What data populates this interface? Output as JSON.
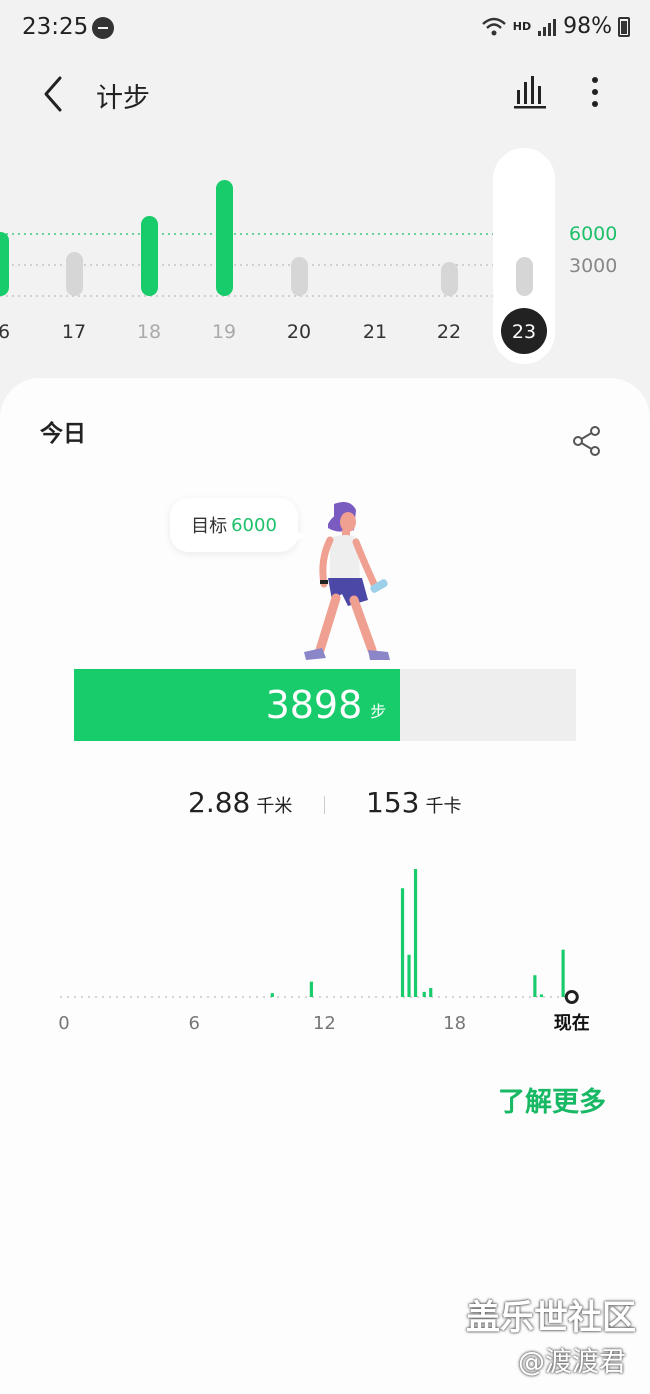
{
  "status": {
    "time": "23:25",
    "network": "HD",
    "battery": "98%"
  },
  "appbar": {
    "title": "计步"
  },
  "week": {
    "days": [
      "6",
      "17",
      "18",
      "19",
      "20",
      "21",
      "22",
      "23"
    ],
    "dim_days": [
      "18",
      "19"
    ],
    "selected": "23",
    "gridline_labels": {
      "goal": "6000",
      "mid": "3000"
    },
    "goal_color": "#1fc06a",
    "bar_color": "#18cc6c",
    "inactive_bar_color": "#d6d6d6"
  },
  "today": {
    "label": "今日",
    "goal_label": "目标",
    "goal_value": "6000",
    "steps": "3898",
    "steps_unit": "步",
    "progress_fraction": 0.65,
    "distance": "2.88",
    "distance_unit": "千米",
    "calories": "153",
    "calories_unit": "千卡"
  },
  "chart_data": {
    "type": "bar",
    "x_ticks": [
      "0",
      "6",
      "12",
      "18",
      "现在"
    ],
    "bars": [
      {
        "hour": 9.6,
        "value": 0.03
      },
      {
        "hour": 11.4,
        "value": 0.12
      },
      {
        "hour": 15.6,
        "value": 0.85
      },
      {
        "hour": 15.9,
        "value": 0.33
      },
      {
        "hour": 16.2,
        "value": 1.0
      },
      {
        "hour": 16.6,
        "value": 0.04
      },
      {
        "hour": 16.9,
        "value": 0.07
      },
      {
        "hour": 21.7,
        "value": 0.17
      },
      {
        "hour": 22.0,
        "value": 0.02
      },
      {
        "hour": 23.0,
        "value": 0.37
      }
    ],
    "color": "#18cc6c"
  },
  "learn_more": "了解更多",
  "watermark": {
    "line1": "盖乐世社区",
    "line2": "@渡渡君"
  }
}
